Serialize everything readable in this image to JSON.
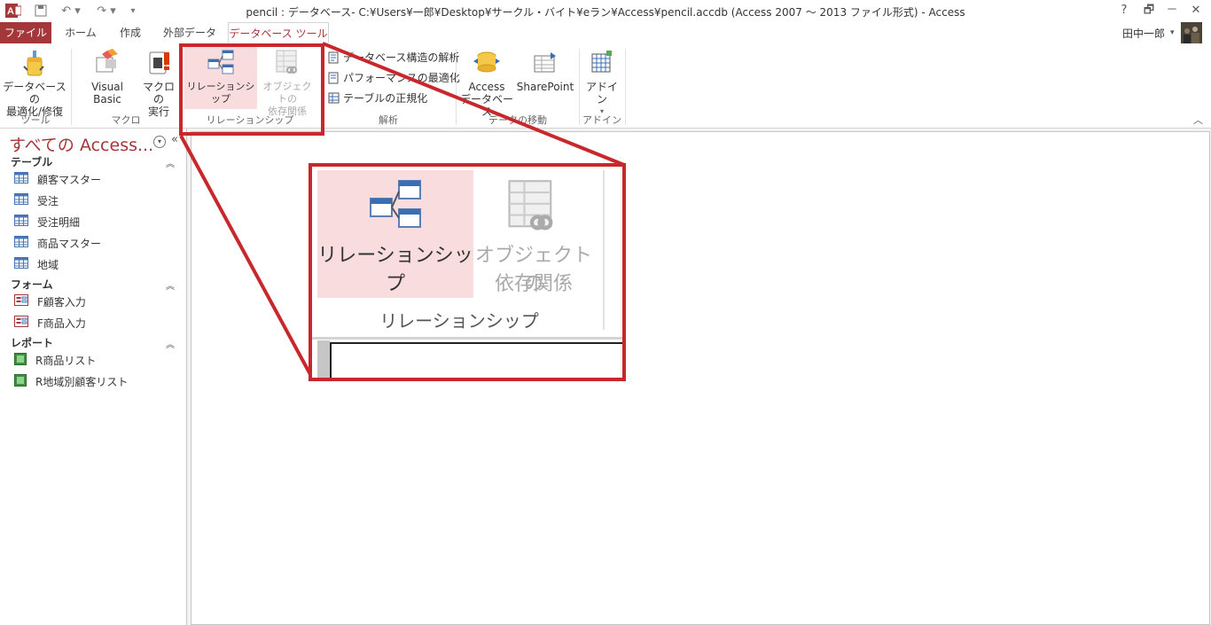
{
  "window": {
    "title": "pencil : データベース- C:¥Users¥一郎¥Desktop¥サークル・バイト¥eラン¥Access¥pencil.accdb (Access 2007 ～ 2013 ファイル形式) - Access",
    "help": "?",
    "restore": "🗗",
    "minimize": "－",
    "close": "✕",
    "user": "田中一郎"
  },
  "tabs": [
    "ファイル",
    "ホーム",
    "作成",
    "外部データ",
    "データベース ツール"
  ],
  "ribbon": {
    "tools": {
      "button": "データベースの\n最適化/修復",
      "group": "ツール"
    },
    "macro": {
      "vb": "Visual Basic",
      "run": "マクロの\n実行",
      "group": "マクロ"
    },
    "relations": {
      "relationship": "リレーションシップ",
      "dependency": "オブジェクトの\n依存関係",
      "group": "リレーションシップ"
    },
    "analyze": {
      "items": [
        "データベース構造の解析",
        "パフォーマンスの最適化",
        "テーブルの正規化"
      ],
      "group": "解析"
    },
    "move": {
      "access": "Access\nデータベース",
      "sharepoint": "SharePoint",
      "group": "データの移動"
    },
    "addin": {
      "button": "アドイン",
      "group": "アドイン"
    }
  },
  "nav": {
    "title": "すべての Access...",
    "sections": [
      {
        "name": "テーブル",
        "items": [
          "顧客マスター",
          "受注",
          "受注明細",
          "商品マスター",
          "地域"
        ]
      },
      {
        "name": "フォーム",
        "items": [
          "F顧客入力",
          "F商品入力"
        ]
      },
      {
        "name": "レポート",
        "items": [
          "R商品リスト",
          "R地域別顧客リスト"
        ]
      }
    ]
  },
  "zoom": {
    "relationship": "リレーションシップ",
    "dependency_1": "オブジェクトの",
    "dependency_2": "依存関係",
    "group": "リレーションシップ"
  },
  "colors": {
    "accent": "#a4373a",
    "highlight": "#c8282b",
    "hover": "#f9dcdd"
  }
}
